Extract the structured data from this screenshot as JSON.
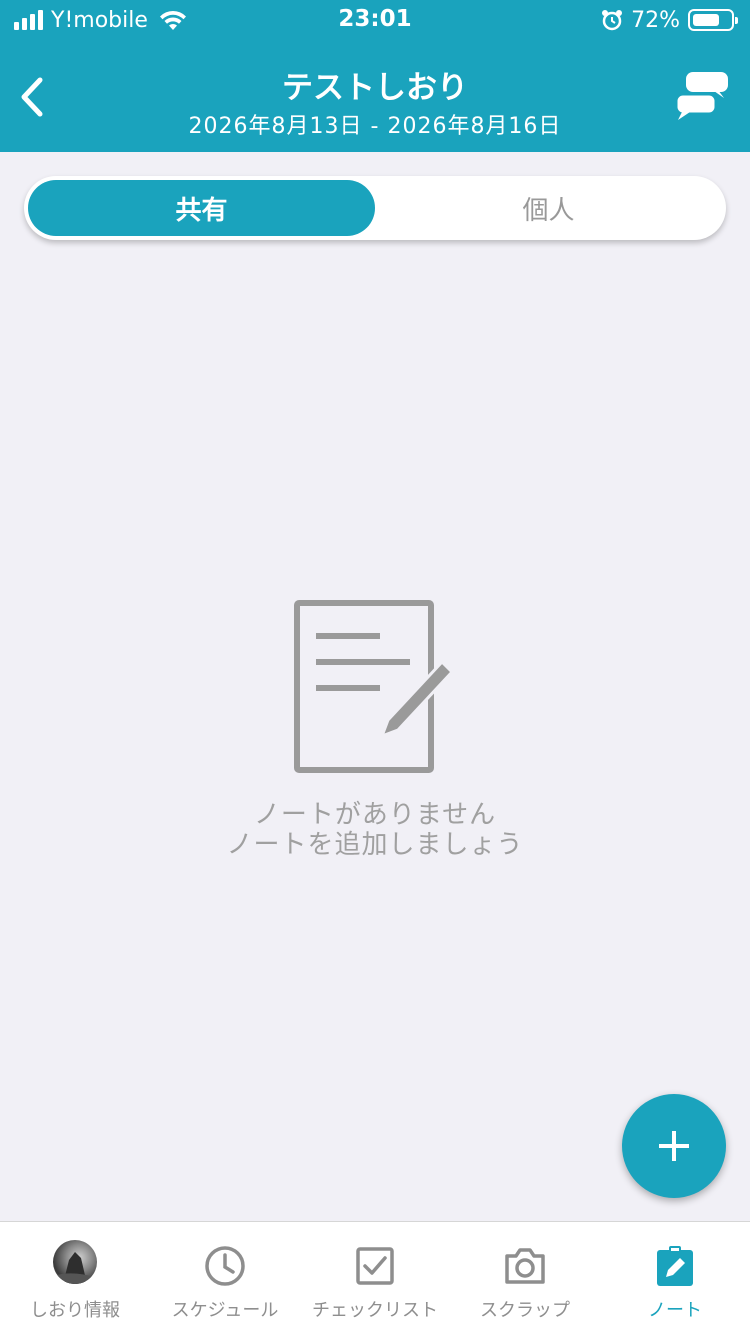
{
  "colors": {
    "accent": "#1aa3bd",
    "inactive_text": "#8e8e8e",
    "empty_text": "#a0a0a0"
  },
  "status_bar": {
    "carrier": "Y!mobile",
    "time": "23:01",
    "battery_percent_label": "72%",
    "battery_level": 0.72,
    "icons": [
      "signal-icon",
      "wifi-icon",
      "alarm-icon",
      "battery-icon"
    ]
  },
  "nav": {
    "title": "テストしおり",
    "subtitle": "2026年8月13日 - 2026年8月16日",
    "icons": [
      "back-chevron-icon",
      "chat-bubbles-icon"
    ]
  },
  "segments": [
    {
      "label": "共有",
      "selected": true
    },
    {
      "label": "個人",
      "selected": false
    }
  ],
  "empty_state": {
    "icon": "note-edit-icon",
    "line1": "ノートがありません",
    "line2": "ノートを追加しましょう"
  },
  "fab": {
    "icon": "plus-icon"
  },
  "tabbar": {
    "items": [
      {
        "label": "しおり情報",
        "icon": "avatar",
        "active": false
      },
      {
        "label": "スケジュール",
        "icon": "clock-icon",
        "active": false
      },
      {
        "label": "チェックリスト",
        "icon": "checkbox-icon",
        "active": false
      },
      {
        "label": "スクラップ",
        "icon": "camera-icon",
        "active": false
      },
      {
        "label": "ノート",
        "icon": "note-pencil-icon",
        "active": true
      }
    ]
  }
}
